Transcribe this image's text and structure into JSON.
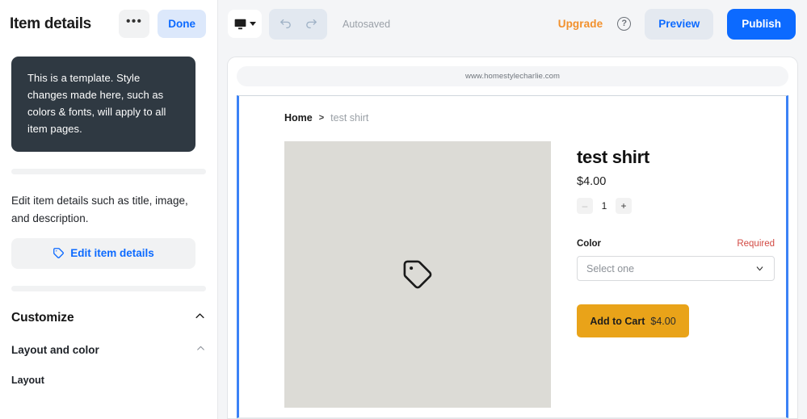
{
  "sidebar": {
    "title": "Item details",
    "more_button": "•••",
    "done_button": "Done",
    "callout_text": "This is a template. Style changes made here, such as colors & fonts, will apply to all item pages.",
    "section_description": "Edit item details such as title, image, and description.",
    "edit_item_button": "Edit item details",
    "customize_label": "Customize",
    "layout_and_color_label": "Layout and color",
    "layout_label": "Layout"
  },
  "topbar": {
    "device_icon": "desktop-monitor-icon",
    "undo_icon": "undo-arrow-icon",
    "redo_icon": "redo-arrow-icon",
    "autosaved_status": "Autosaved",
    "upgrade_label": "Upgrade",
    "help_icon_glyph": "?",
    "preview_button": "Preview",
    "publish_button": "Publish"
  },
  "preview": {
    "url": "www.homestylecharlie.com",
    "breadcrumb": {
      "home": "Home",
      "separator": ">",
      "current": "test shirt"
    },
    "product": {
      "image_placeholder_icon": "price-tag-icon",
      "title": "test shirt",
      "price": "$4.00",
      "quantity": {
        "decrement": "–",
        "value": "1",
        "increment": "+"
      },
      "option": {
        "label": "Color",
        "required_badge": "Required",
        "select_placeholder": "Select one"
      },
      "add_to_cart": {
        "label": "Add to Cart",
        "price": "$4.00"
      }
    }
  },
  "colors": {
    "accent_blue": "#0c6aff",
    "selection_blue": "#3b82f6",
    "upgrade_orange": "#f2902b",
    "required_red": "#d24a43",
    "cart_yellow": "#e9a319",
    "callout_dark": "#2f3942",
    "image_placeholder_gray": "#dcdbd6"
  }
}
